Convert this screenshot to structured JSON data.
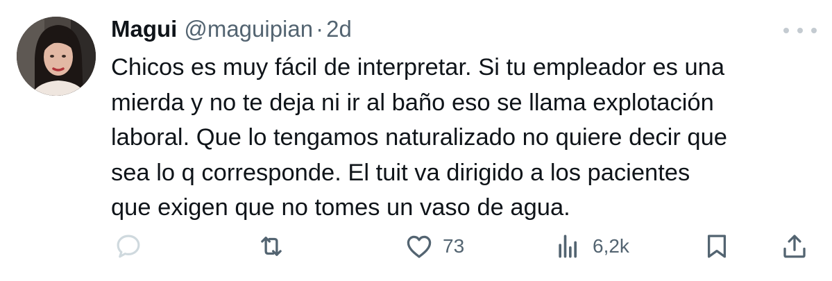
{
  "tweet": {
    "display_name": "Magui",
    "handle": "@maguipian",
    "separator": "·",
    "time": "2d",
    "text": "Chicos es muy fácil de interpretar. Si tu empleador es una\nmierda y no te deja ni ir al baño eso se llama explotación\nlaboral. Que lo tengamos naturalizado no quiere decir que\nsea lo q corresponde. El tuit va dirigido a los pacientes\nque exigen que no tomes un vaso de agua."
  },
  "actions": {
    "reply": {
      "icon": "reply-icon",
      "count": ""
    },
    "retweet": {
      "icon": "retweet-icon",
      "count": ""
    },
    "like": {
      "icon": "heart-icon",
      "count": "73"
    },
    "views": {
      "icon": "views-icon",
      "count": "6,2k"
    },
    "bookmark": {
      "icon": "bookmark-icon"
    },
    "share": {
      "icon": "share-icon"
    }
  },
  "colors": {
    "text_primary": "#0f1419",
    "text_secondary": "#536471",
    "reply_icon_faded": "#cfd9de"
  }
}
